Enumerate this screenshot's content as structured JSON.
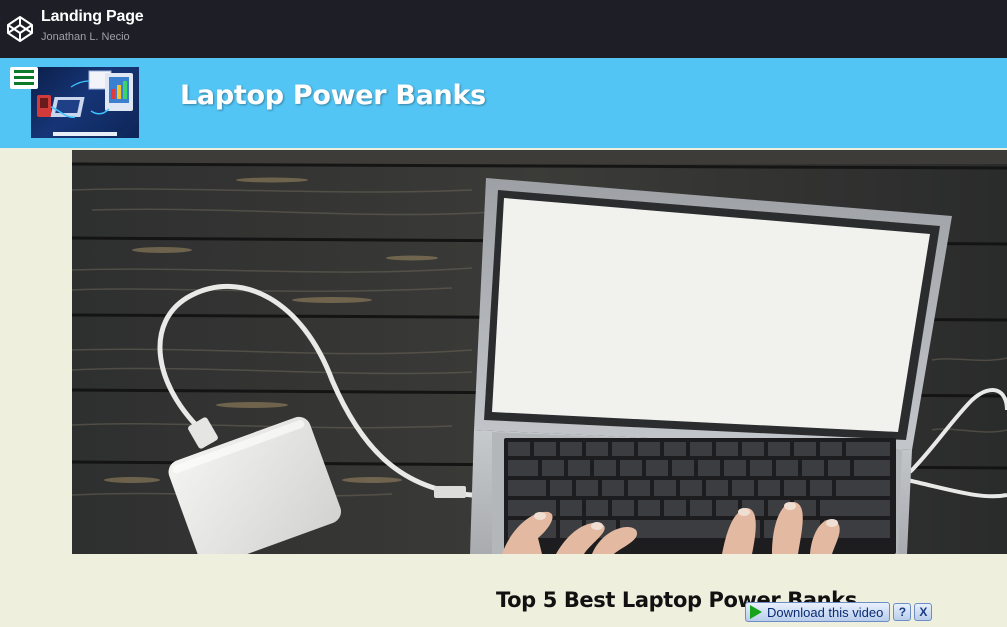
{
  "topbar": {
    "title": "Landing Page",
    "author": "Jonathan L. Necio",
    "logo_icon": "codepen-logo-icon"
  },
  "header": {
    "menu_icon": "hamburger-menu-icon",
    "title": "Laptop Power Banks",
    "background_color": "#53c5f5"
  },
  "main": {
    "subtitle": "Top 5 Best Laptop Power Banks"
  },
  "download_bar": {
    "label": "Download this video",
    "help_label": "?",
    "close_label": "X"
  }
}
